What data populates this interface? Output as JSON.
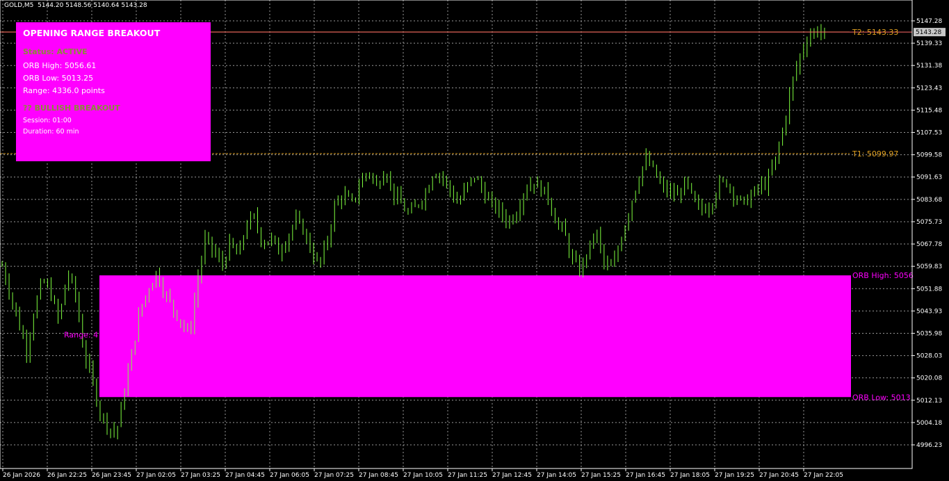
{
  "header": {
    "symbol": "GOLD,M5",
    "ohlc": "5144.20 5148.56 5140.64 5143.28"
  },
  "panel": {
    "title": "OPENING RANGE BREAKOUT",
    "status": "Status: ACTIVE",
    "orb_high": "ORB High: 5056.61",
    "orb_low": "ORB Low:  5013.25",
    "range": "Range: 4336.0 points",
    "breakout": "?? BULLISH BREAKOUT",
    "session": "Session: 01:00",
    "duration": "Duration: 60 min",
    "bg_color": "#ff00ff",
    "breakout_color": "#8a8a3a"
  },
  "levels": {
    "t2_label": "T2: 5143.33",
    "t2_value": 5143.33,
    "t1_label": "T1: 5099.97",
    "t1_value": 5099.97,
    "orb_high_label": "ORB High: 5056",
    "orb_high_value": 5056.61,
    "orb_low_label": "ORB Low: 5013",
    "orb_low_value": 5013.25,
    "range_label": "Range: 4",
    "current_price": "5143.28",
    "current_value": 5143.28
  },
  "colors": {
    "candle": "#7fff3f",
    "orb_box": "#ff00ff",
    "target": "#e0a020",
    "grid": "#9a9a9a",
    "axis": "#ffffff",
    "price_line": "#ff6a6a"
  },
  "y_axis": {
    "ticks": [
      "5147.28",
      "5139.33",
      "5131.38",
      "5123.43",
      "5115.48",
      "5107.53",
      "5099.58",
      "5091.63",
      "5083.68",
      "5075.73",
      "5067.78",
      "5059.83",
      "5051.88",
      "5043.93",
      "5035.98",
      "5028.03",
      "5020.08",
      "5012.13",
      "5004.18",
      "4996.23"
    ],
    "values": [
      5147.28,
      5139.33,
      5131.38,
      5123.43,
      5115.48,
      5107.53,
      5099.58,
      5091.63,
      5083.68,
      5075.73,
      5067.78,
      5059.83,
      5051.88,
      5043.93,
      5035.98,
      5028.03,
      5020.08,
      5012.13,
      5004.18,
      4996.23
    ]
  },
  "x_axis": {
    "ticks": [
      "26 Jan 2026",
      "26 Jan 22:25",
      "26 Jan 23:45",
      "27 Jan 02:05",
      "27 Jan 03:25",
      "27 Jan 04:45",
      "27 Jan 06:05",
      "27 Jan 07:25",
      "27 Jan 08:45",
      "27 Jan 10:05",
      "27 Jan 11:25",
      "27 Jan 12:45",
      "27 Jan 14:05",
      "27 Jan 15:25",
      "27 Jan 16:45",
      "27 Jan 18:05",
      "27 Jan 19:25",
      "27 Jan 20:45",
      "27 Jan 22:05"
    ]
  },
  "chart_data": {
    "type": "candlestick",
    "symbol": "GOLD,M5",
    "ylim": [
      4993,
      5150
    ],
    "x_ticks": [
      "26 Jan 2026",
      "26 Jan 22:25",
      "26 Jan 23:45",
      "27 Jan 02:05",
      "27 Jan 03:25",
      "27 Jan 04:45",
      "27 Jan 06:05",
      "27 Jan 07:25",
      "27 Jan 08:45",
      "27 Jan 10:05",
      "27 Jan 11:25",
      "27 Jan 12:45",
      "27 Jan 14:05",
      "27 Jan 15:25",
      "27 Jan 16:45",
      "27 Jan 18:05",
      "27 Jan 19:25",
      "27 Jan 20:45",
      "27 Jan 22:05"
    ],
    "path_closes": [
      5060,
      5050,
      5040,
      5030,
      5045,
      5055,
      5050,
      5040,
      5058,
      5050,
      5030,
      5020,
      5008,
      5003,
      5000,
      5015,
      5030,
      5045,
      5052,
      5058,
      5050,
      5045,
      5040,
      5035,
      5055,
      5070,
      5065,
      5060,
      5068,
      5063,
      5075,
      5077,
      5068,
      5070,
      5065,
      5070,
      5076,
      5073,
      5065,
      5060,
      5070,
      5083,
      5085,
      5082,
      5090,
      5094,
      5088,
      5095,
      5086,
      5082,
      5078,
      5082,
      5086,
      5094,
      5092,
      5087,
      5082,
      5088,
      5092,
      5087,
      5082,
      5080,
      5076,
      5078,
      5086,
      5090,
      5088,
      5085,
      5076,
      5072,
      5062,
      5058,
      5066,
      5072,
      5060,
      5059,
      5070,
      5080,
      5090,
      5098,
      5094,
      5088,
      5086,
      5085,
      5090,
      5082,
      5080,
      5082,
      5089,
      5090,
      5085,
      5082,
      5085,
      5088,
      5090,
      5098,
      5110,
      5125,
      5135,
      5142,
      5144,
      5143
    ]
  }
}
